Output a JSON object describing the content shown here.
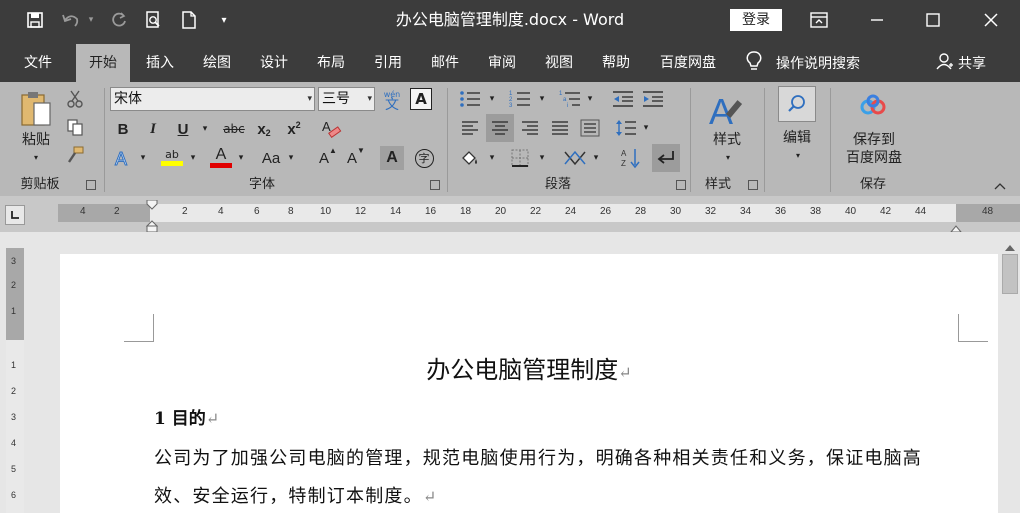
{
  "app": {
    "window_title": "办公电脑管理制度.docx  -  Word",
    "login_label": "登录"
  },
  "tabs": [
    {
      "label": "文件"
    },
    {
      "label": "开始"
    },
    {
      "label": "插入"
    },
    {
      "label": "绘图"
    },
    {
      "label": "设计"
    },
    {
      "label": "布局"
    },
    {
      "label": "引用"
    },
    {
      "label": "邮件"
    },
    {
      "label": "审阅"
    },
    {
      "label": "视图"
    },
    {
      "label": "帮助"
    },
    {
      "label": "百度网盘"
    }
  ],
  "tell_me": "操作说明搜索",
  "share": "共享",
  "ribbon": {
    "clipboard": {
      "paste": "粘贴",
      "group": "剪贴板"
    },
    "font": {
      "name": "宋体",
      "size": "三号",
      "group": "字体",
      "wen_label": "wén",
      "wen_char": "文",
      "box_a": "A",
      "bold": "B",
      "italic": "I",
      "underline": "U",
      "strike": "abc",
      "sub": "x",
      "sub_s": "2",
      "sup": "x",
      "sup_s": "2",
      "highlight_text": "ab",
      "font_color": "A",
      "change_case": "Aa",
      "grow": "A",
      "shrink": "A",
      "char_shade": "A",
      "enclose": "字"
    },
    "paragraph": {
      "group": "段落"
    },
    "styles": {
      "label": "样式",
      "group": "样式"
    },
    "editing": {
      "label": "编辑"
    },
    "baidu": {
      "label_line1": "保存到",
      "label_line2": "百度网盘",
      "group": "保存"
    }
  },
  "ruler": {
    "ticks": [
      "4",
      "2",
      "2",
      "4",
      "6",
      "8",
      "10",
      "12",
      "14",
      "16",
      "18",
      "20",
      "22",
      "24",
      "26",
      "28",
      "30",
      "32",
      "34",
      "36",
      "38",
      "40",
      "42",
      "44",
      "48"
    ],
    "vticks": [
      "3",
      "2",
      "1",
      "1",
      "2",
      "3",
      "4",
      "5",
      "6"
    ]
  },
  "document": {
    "title": "办公电脑管理制度",
    "heading1": "1 目的",
    "para_line1": "公司为了加强公司电脑的管理，规范电脑使用行为，明确各种相关责任和义务，保证电脑高",
    "para_line2": "效、安全运行，特制订本制度。",
    "para_mark": "↵"
  },
  "colors": {
    "titlebar": "#3c3c3c",
    "ribbon": "#b8b8b8",
    "accent_blue": "#2f6fbf",
    "font_color_red": "#e00000",
    "highlight_yellow": "#ffff00"
  }
}
